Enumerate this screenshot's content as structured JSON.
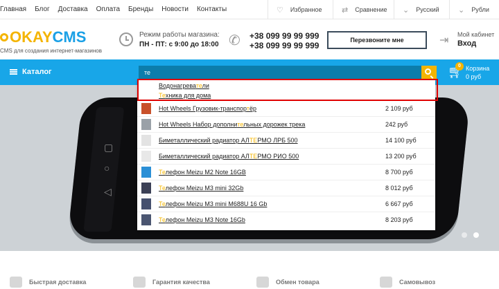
{
  "topnav": [
    "Главная",
    "Блог",
    "Доставка",
    "Оплата",
    "Бренды",
    "Новости",
    "Контакты"
  ],
  "topbar": {
    "favorites": "Избранное",
    "compare": "Сравнение",
    "language": "Русский",
    "currency": "Рубли"
  },
  "logo": {
    "ok": "OKAY",
    "cms": "CMS",
    "tagline": "CMS для создания интернет-магазинов"
  },
  "header": {
    "hours_label": "Режим работы магазина:",
    "hours_value": "ПН - ПТ: с 9:00 до 18:00",
    "phone1": "+38 099 99 99 999",
    "phone2": "+38 099 99 99 999",
    "callback": "Перезвоните мне",
    "account_label": "Мой кабинет",
    "account_login": "Вход"
  },
  "navbar": {
    "catalog": "Каталог",
    "search_value": "те",
    "cart_label": "Корзина",
    "cart_total": "0 руб",
    "cart_count": "0"
  },
  "suggestions": [
    {
      "pre": "Водонагрева",
      "hl": "те",
      "post": "ли"
    },
    {
      "pre": "",
      "hl": "Те",
      "post": "хника для дома"
    }
  ],
  "products": [
    {
      "pre": "Hot Wheels Грузовик-транспор",
      "hl": "т",
      "post": "ёр",
      "price": "2 109 руб",
      "thumb": "#c8502a"
    },
    {
      "pre": "Hot Wheels Набор дополни",
      "hl": "те",
      "post": "льных дорожек трека",
      "price": "242 руб",
      "thumb": "#9aa1a8"
    },
    {
      "pre": "Биметаллический радиатор АЛ",
      "hl": "ТЕ",
      "post": "РМО ЛРБ 500",
      "price": "14 100 руб",
      "thumb": "#e3e3e3"
    },
    {
      "pre": "Биметаллический радиатор АЛ",
      "hl": "ТЕ",
      "post": "РМО РИО 500",
      "price": "13 200 руб",
      "thumb": "#e8e8e8"
    },
    {
      "pre": "",
      "hl": "Те",
      "post": "лефон Meizu M2 Note 16GB",
      "price": "8 700 руб",
      "thumb": "#2a8fd6"
    },
    {
      "pre": "",
      "hl": "Те",
      "post": "лефон Meizu M3 mini 32Gb",
      "price": "8 012 руб",
      "thumb": "#3a3f55"
    },
    {
      "pre": "",
      "hl": "Те",
      "post": "лефон Meizu M3 mini M688U 16 Gb",
      "price": "6 667 руб",
      "thumb": "#45506e"
    },
    {
      "pre": "",
      "hl": "Те",
      "post": "лефон Meizu M3 Note 16Gb",
      "price": "8 203 руб",
      "thumb": "#4a5570"
    }
  ],
  "features": [
    "Быстрая доставка",
    "Гарантия качества",
    "Обмен товара",
    "Самовывоз"
  ],
  "colors": {
    "accent": "#18a6e8",
    "brand_yellow": "#f4b400",
    "search_bg": "#0c7dab",
    "highlight_border": "#e00000"
  }
}
